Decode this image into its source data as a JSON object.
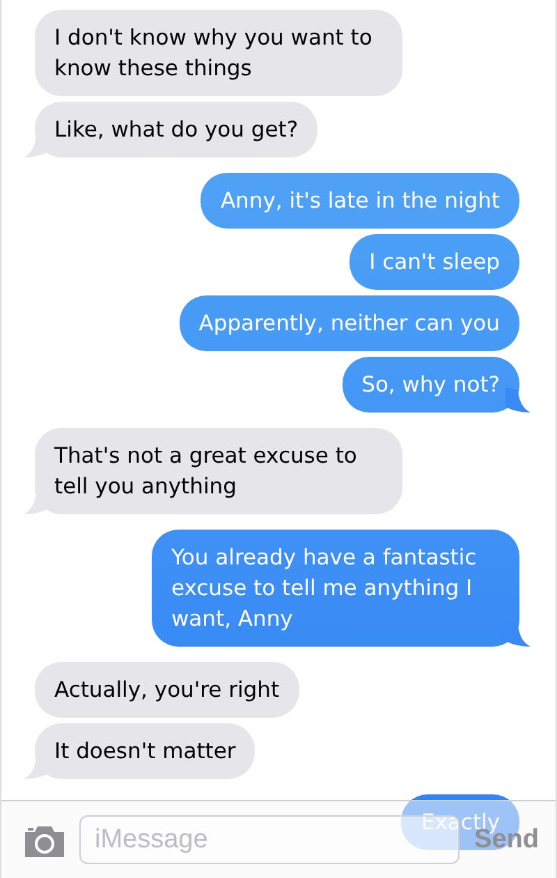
{
  "messages": [
    {
      "kind": "received",
      "text": "I don't know why you want to know these things",
      "tail": false
    },
    {
      "kind": "received",
      "text": "Like, what do you get?",
      "tail": true
    },
    {
      "kind": "sent",
      "text": "Anny, it's late in the night",
      "tail": false
    },
    {
      "kind": "sent",
      "text": "I can't sleep",
      "tail": false
    },
    {
      "kind": "sent",
      "text": "Apparently, neither can you",
      "tail": false
    },
    {
      "kind": "sent",
      "text": "So, why not?",
      "tail": true
    },
    {
      "kind": "received",
      "text": "That's not a great excuse to tell you anything",
      "tail": true
    },
    {
      "kind": "sent",
      "text": "You already have a fantastic excuse to tell me anything I want, Anny",
      "tail": true
    },
    {
      "kind": "received",
      "text": "Actually, you're right",
      "tail": false
    },
    {
      "kind": "received",
      "text": "It doesn't matter",
      "tail": true
    },
    {
      "kind": "sent",
      "text": "Exactly",
      "tail": false
    }
  ],
  "composer": {
    "placeholder": "iMessage",
    "send_button": {
      "label": "Send",
      "disabled": true
    }
  }
}
